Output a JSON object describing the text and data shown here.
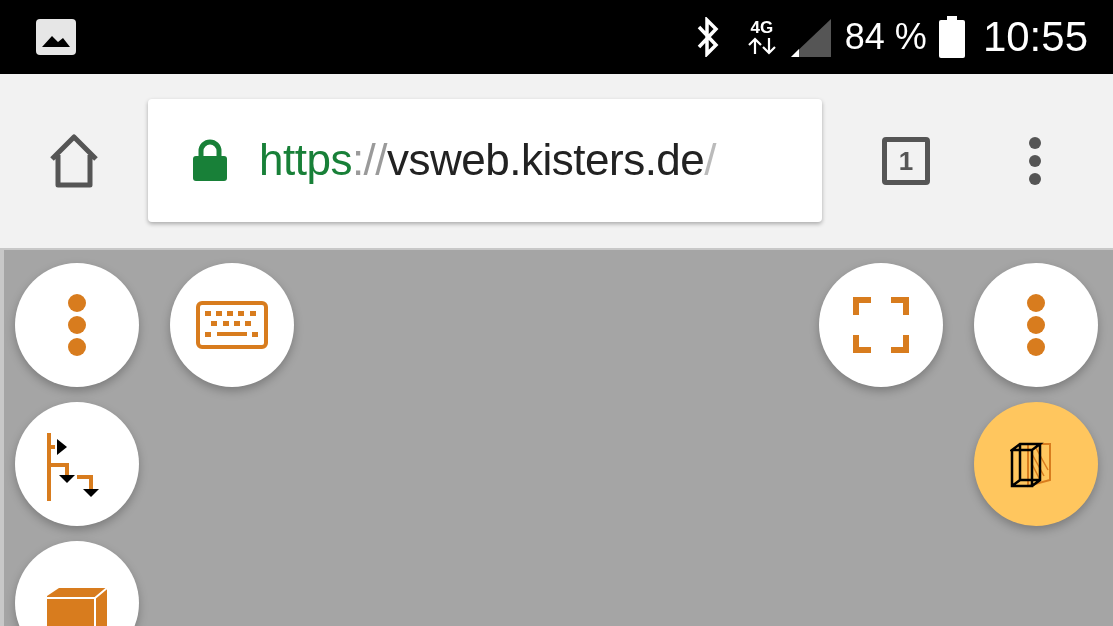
{
  "status_bar": {
    "network": "4G",
    "battery": "84 %",
    "time": "10:55"
  },
  "browser": {
    "url": {
      "scheme": "https",
      "separator": "://",
      "host": "vsweb.kisters.de",
      "path": "/"
    },
    "tab_count": "1"
  },
  "left_tools": [
    {
      "kind": "menu",
      "active": false
    },
    {
      "kind": "keyboard",
      "active": false
    },
    {
      "kind": "tree",
      "active": false
    },
    {
      "kind": "cube",
      "active": false
    }
  ],
  "right_tools": [
    {
      "kind": "fullscreen",
      "active": false
    },
    {
      "kind": "menu",
      "active": false
    },
    {
      "kind": "section-box",
      "active": true
    }
  ]
}
